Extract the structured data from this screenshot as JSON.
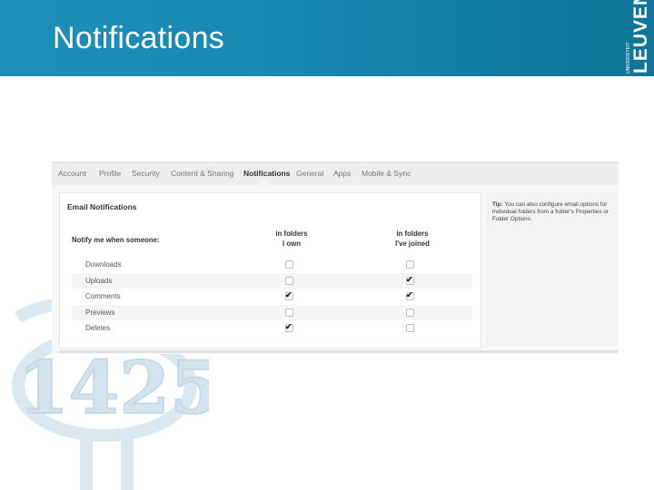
{
  "header": {
    "title": "Notifications",
    "logo_text": "LEUVEN",
    "logo_small_text": "UNIVERSITEIT",
    "banner_color": "#1789b2"
  },
  "tabs": [
    {
      "label": "Account",
      "active": false
    },
    {
      "label": "Profile",
      "active": false
    },
    {
      "label": "Security",
      "active": false
    },
    {
      "label": "Content & Sharing",
      "active": false
    },
    {
      "label": "Notifications",
      "active": true
    },
    {
      "label": "General",
      "active": false
    },
    {
      "label": "Apps",
      "active": false
    },
    {
      "label": "Mobile & Sync",
      "active": false
    }
  ],
  "email": {
    "section_title": "Email Notifications",
    "notify_label": "Notify me when someone:",
    "columns": [
      {
        "line1": "in folders",
        "line2": "I own"
      },
      {
        "line1": "in folders",
        "line2": "I've joined"
      }
    ],
    "rows": [
      {
        "label": "Downloads",
        "own": false,
        "joined": false
      },
      {
        "label": "Uploads",
        "own": false,
        "joined": true
      },
      {
        "label": "Comments",
        "own": true,
        "joined": true
      },
      {
        "label": "Previews",
        "own": false,
        "joined": false
      },
      {
        "label": "Deletes",
        "own": true,
        "joined": false
      }
    ]
  },
  "tip": {
    "prefix": "Tip:",
    "text": "You can also configure email options for individual folders from a folder's Properties or Folder Options."
  },
  "watermark": {
    "text": "1425"
  }
}
